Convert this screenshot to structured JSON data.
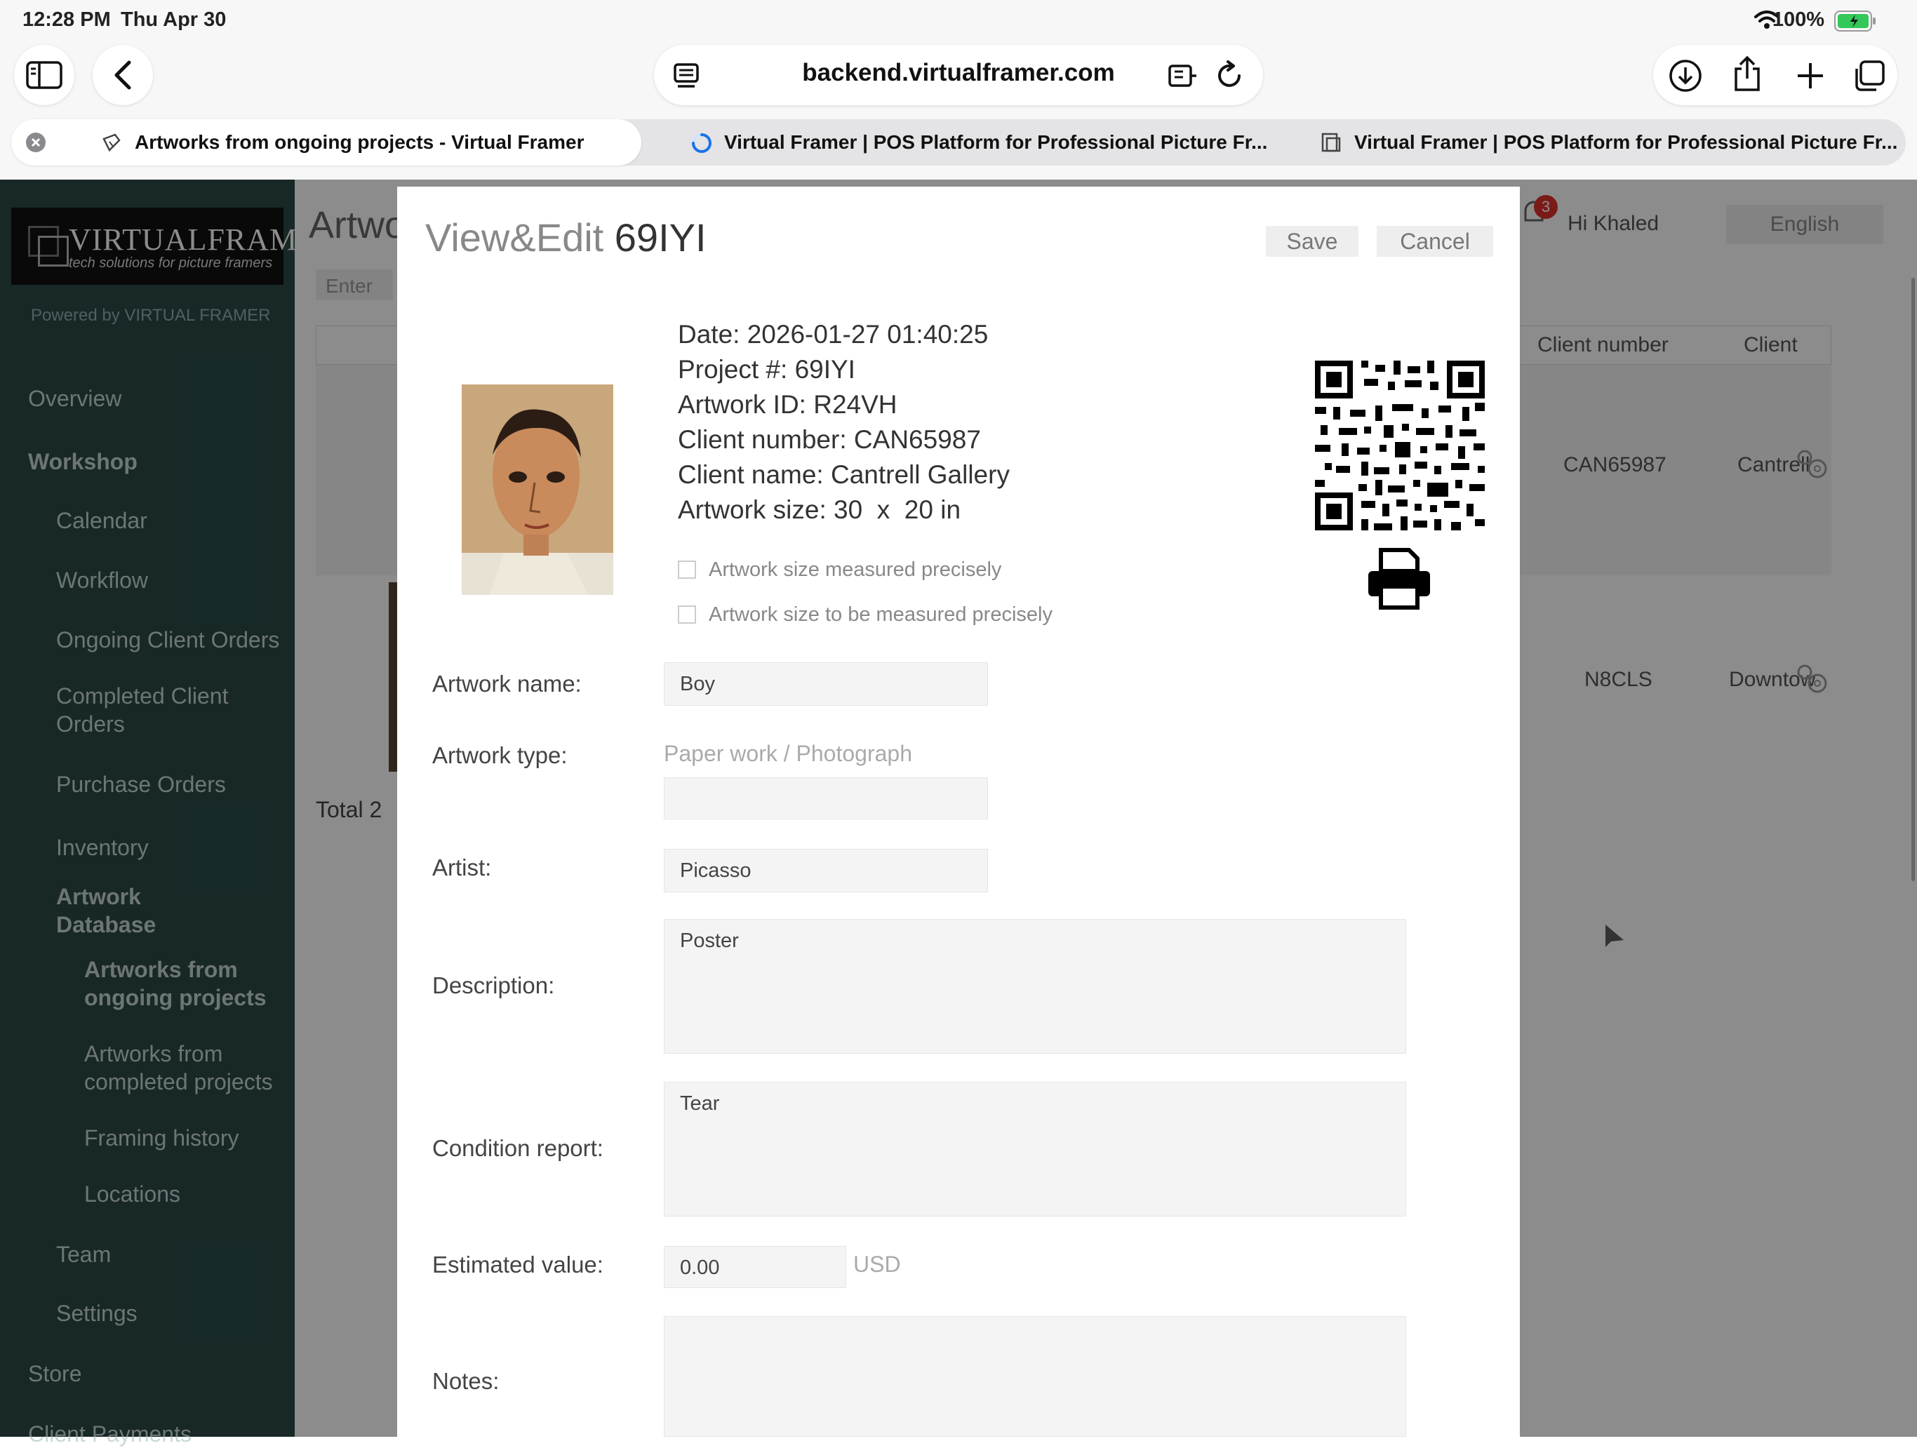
{
  "status_bar": {
    "time": "12:28 PM",
    "date": "Thu Apr 30",
    "battery": "100%"
  },
  "browser": {
    "url": "backend.virtualframer.com",
    "tabs": [
      {
        "title": "Artworks from ongoing projects - Virtual Framer"
      },
      {
        "title": "Virtual Framer | POS Platform for Professional Picture Fr..."
      },
      {
        "title": "Virtual Framer | POS Platform for Professional Picture Fr..."
      }
    ]
  },
  "sidebar": {
    "logo_main": "VIRTUALFRAMER",
    "logo_sub": "tech solutions for picture framers",
    "powered_by": "Powered by VIRTUAL FRAMER",
    "items": {
      "overview": "Overview",
      "workshop": "Workshop",
      "calendar": "Calendar",
      "workflow": "Workflow",
      "ongoing_orders": "Ongoing Client Orders",
      "completed_orders_1": "Completed Client",
      "completed_orders_2": "Orders",
      "purchase_orders": "Purchase Orders",
      "inventory": "Inventory",
      "artwork_db_1": "Artwork",
      "artwork_db_2": "Database",
      "ongoing_projects_1": "Artworks from",
      "ongoing_projects_2": "ongoing projects",
      "completed_projects_1": "Artworks from",
      "completed_projects_2": "completed projects",
      "framing_history": "Framing history",
      "locations": "Locations",
      "team": "Team",
      "settings": "Settings",
      "store": "Store",
      "client_payments": "Client Payments"
    }
  },
  "background_page": {
    "title": "Artwo",
    "search_placeholder": "Enter",
    "header_greeting": "Hi Khaled",
    "language": "English",
    "notification_count": "3",
    "columns": [
      "Client number",
      "Client"
    ],
    "rows": [
      {
        "client_number": "CAN65987",
        "client": "Cantrell"
      },
      {
        "client_number": "N8CLS",
        "client": "Downtow"
      }
    ],
    "total": "Total 2"
  },
  "modal": {
    "title_prefix": "View&Edit",
    "title_number": "69IYI",
    "save": "Save",
    "cancel": "Cancel",
    "info": {
      "date": "Date: 2026-01-27 01:40:25",
      "project": "Project #: 69IYI",
      "artwork_id": "Artwork ID: R24VH",
      "client_number": "Client number: CAN65987",
      "client_name": "Client name: Cantrell Gallery",
      "artwork_size": "Artwork size: 30  x  20 in"
    },
    "checkboxes": {
      "measured": "Artwork size measured precisely",
      "to_measure": "Artwork size to be measured precisely"
    },
    "fields": {
      "artwork_name_label": "Artwork name:",
      "artwork_name": "Boy",
      "artwork_type_label": "Artwork type:",
      "artwork_type_hint": "Paper work / Photograph",
      "artist_label": "Artist:",
      "artist": "Picasso",
      "description_label": "Description:",
      "description": "Poster",
      "condition_label": "Condition report:",
      "condition": "Tear",
      "value_label": "Estimated value:",
      "value": "0.00",
      "currency": "USD",
      "notes_label": "Notes:"
    }
  }
}
